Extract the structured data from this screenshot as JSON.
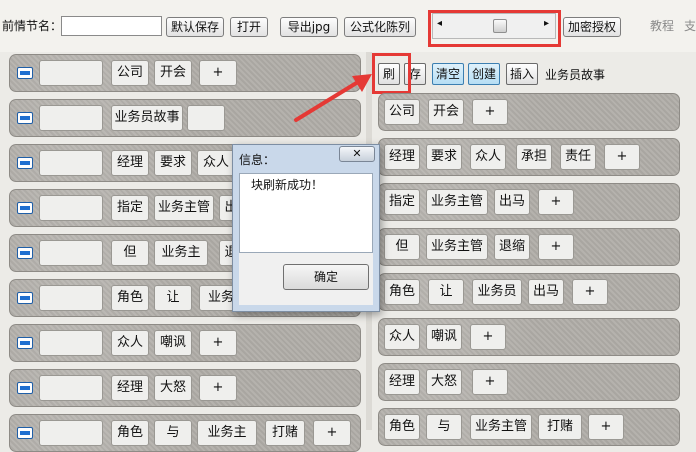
{
  "toolbar": {
    "chapter_label": "前情节名：",
    "chapter_value": "",
    "buttons": [
      "默认保存",
      "打开",
      "导出jpg",
      "公式化陈列",
      "加密授权"
    ],
    "scroll_left_arrow": "◂",
    "scroll_right_arrow": "▸",
    "tutorial_label": "教程",
    "support_label": "支"
  },
  "left_rows": [
    {
      "cells": [
        "公司",
        "开会",
        "+"
      ]
    },
    {
      "cells": [
        "业务员故事",
        ""
      ]
    },
    {
      "cells": [
        "经理",
        "要求",
        "众人"
      ]
    },
    {
      "cells": [
        "指定",
        "业务主管",
        "出"
      ]
    },
    {
      "cells": [
        "但",
        "业务主",
        "退"
      ]
    },
    {
      "cells": [
        "角色",
        "让",
        "业务"
      ]
    },
    {
      "cells": [
        "众人",
        "嘲讽",
        "+"
      ]
    },
    {
      "cells": [
        "经理",
        "大怒",
        "+"
      ]
    },
    {
      "cells": [
        "角色",
        "与",
        "业务主",
        "打赌",
        "+"
      ]
    }
  ],
  "right_toolbar": {
    "buttons": [
      "刷",
      "存",
      "清空",
      "创建",
      "插入"
    ],
    "story_title": "业务员故事"
  },
  "right_rows": [
    {
      "cells": [
        "公司",
        "开会",
        "+"
      ]
    },
    {
      "cells": [
        "经理",
        "要求",
        "众人",
        "承担",
        "责任",
        "+"
      ]
    },
    {
      "cells": [
        "指定",
        "业务主管",
        "出马",
        "+"
      ]
    },
    {
      "cells": [
        "但",
        "业务主管",
        "退缩",
        "+"
      ]
    },
    {
      "cells": [
        "角色",
        "让",
        "业务员",
        "出马",
        "+"
      ]
    },
    {
      "cells": [
        "众人",
        "嘲讽",
        "+"
      ]
    },
    {
      "cells": [
        "经理",
        "大怒",
        "+"
      ]
    },
    {
      "cells": [
        "角色",
        "与",
        "业务主管",
        "打赌",
        "+"
      ]
    }
  ],
  "dialog": {
    "title": "信息：",
    "close": "✕",
    "message": "块刷新成功！",
    "ok": "确定"
  },
  "colors": {
    "highlight": "#e53935",
    "arrow": "#e53935",
    "toggle": "#1f6fd0"
  }
}
